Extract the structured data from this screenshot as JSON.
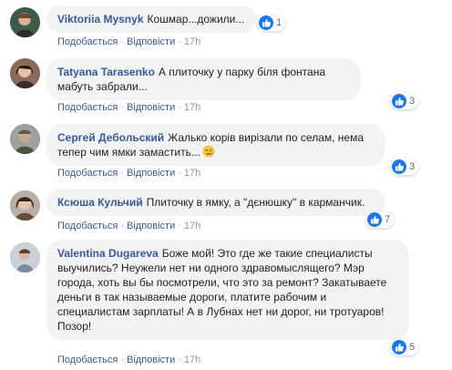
{
  "comments": [
    {
      "author": "Viktoriia Mysnyk",
      "text": "Кошмар...дожили...",
      "likes": "1",
      "like_label": "Подобається",
      "reply_label": "Відповісти",
      "time": "17h"
    },
    {
      "author": "Tatyana Tarasenko",
      "text": "А плиточку у парку біля фонтана мабуть забрали...",
      "likes": "3",
      "like_label": "Подобається",
      "reply_label": "Відповісти",
      "time": "17h"
    },
    {
      "author": "Сергей Дебольский",
      "text": "Жалько корів вирізали по селам, нема тепер чим ямки замастить...",
      "emoji": "crying-face-icon",
      "likes": "3",
      "like_label": "Подобається",
      "reply_label": "Відповісти",
      "time": "17h"
    },
    {
      "author": "Ксюша Кульчий",
      "text": "Плиточку в ямку, а \"дєнюшку\" в карманчик.",
      "likes": "7",
      "like_label": "Подобається",
      "reply_label": "Відповісти",
      "time": "17h"
    },
    {
      "author": "Valentina Dugareva",
      "text": "Боже мой! Это где же такие специалисты выучились? Неужели нет ни одного здравомыслящего? Мэр города, хоть вы бы посмотрели, что это за ремонт? Закатываете деньги в так называемые дороги, платите рабочим и специалистам зарплаты! А в Лубнах нет ни дорог, ни тротуаров! Позор!",
      "likes": "5",
      "like_label": "Подобається",
      "reply_label": "Відповісти",
      "time": "17h"
    }
  ],
  "separator": "·",
  "colors": {
    "author": "#385898",
    "bubble": "#f2f3f5",
    "like_badge": "#1877f2",
    "meta": "#90949c"
  },
  "icons": {
    "like": "thumbs-up-icon"
  }
}
